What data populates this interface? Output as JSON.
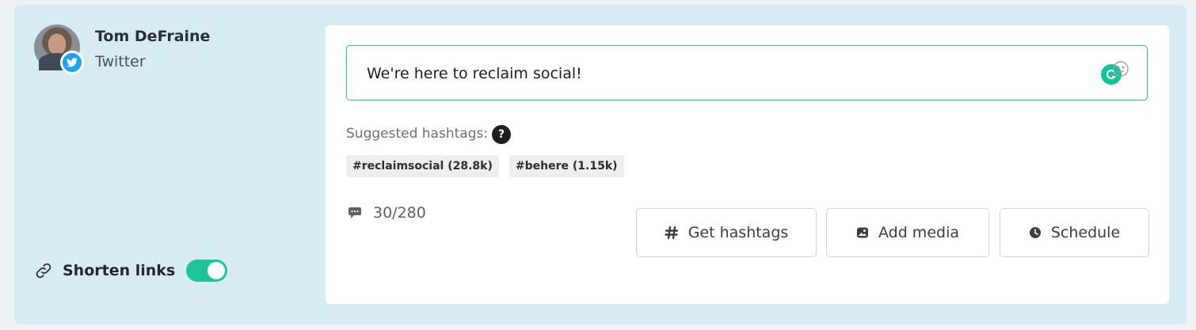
{
  "profile": {
    "name": "Tom DeFraine",
    "network": "Twitter",
    "avatar_icon": "user-photo",
    "network_icon": "twitter-bird-icon"
  },
  "shorten_links": {
    "label": "Shorten links",
    "enabled": true,
    "icon": "link-icon"
  },
  "composer": {
    "text": "We're here to reclaim social!",
    "suggested_label": "Suggested hashtags:",
    "help_glyph": "?",
    "hashtags": [
      "#reclaimsocial (28.8k)",
      "#behere (1.15k)"
    ],
    "char_count": "30/280"
  },
  "actions": {
    "get_hashtags": "Get hashtags",
    "add_media": "Add media",
    "schedule": "Schedule"
  },
  "colors": {
    "accent": "#1fc59a",
    "twitter": "#1da1f2",
    "panel_bg": "#d6ecf2"
  }
}
